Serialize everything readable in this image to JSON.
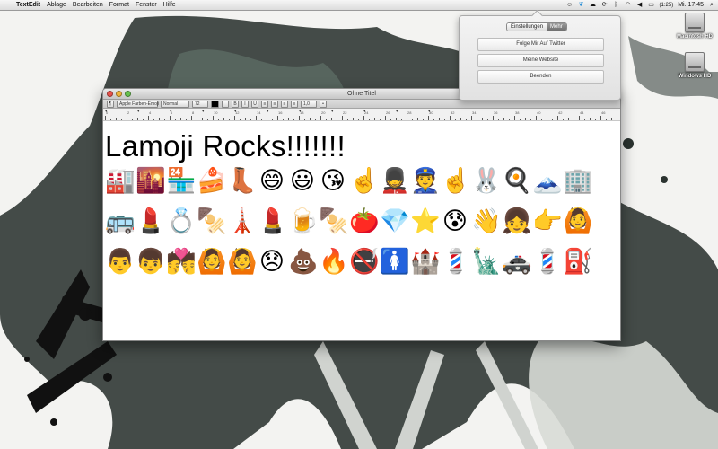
{
  "menubar": {
    "apple_glyph": "",
    "app_name": "TextEdit",
    "menus": [
      "Ablage",
      "Bearbeiten",
      "Format",
      "Fenster",
      "Hilfe"
    ],
    "battery": "(1:25)",
    "clock": "Mi. 17:45",
    "status_icons": [
      "lamoji-icon",
      "twitter-bird-icon",
      "cloud-icon",
      "sync-icon",
      "bluetooth-icon",
      "wifi-icon",
      "volume-icon",
      "battery-icon",
      "spotlight-icon"
    ]
  },
  "desktop": {
    "icons": [
      {
        "label": "Macintosh HD"
      },
      {
        "label": "Windows HD"
      }
    ]
  },
  "popover": {
    "tabs": [
      {
        "label": "Einstellungen",
        "selected": false
      },
      {
        "label": "Mehr",
        "selected": true
      }
    ],
    "buttons": [
      "Folge Mir Auf Twitter",
      "Meine Website",
      "Beenden"
    ]
  },
  "window": {
    "title": "Ohne Titel",
    "toolbar": {
      "font_family": "Apple Farben-Emoji",
      "typeface": "Normal",
      "font_size": "72",
      "styles": [
        "B",
        "I",
        "U"
      ],
      "line_spacing": "1,0"
    },
    "ruler_numbers": [
      "0",
      "2",
      "4",
      "6",
      "8",
      "10",
      "12",
      "14",
      "16",
      "18",
      "20",
      "22",
      "24",
      "26",
      "28",
      "30",
      "32",
      "34",
      "36",
      "38",
      "40",
      "42",
      "44",
      "46"
    ],
    "document": {
      "heading": "Lamoji Rocks!!!!!!!",
      "emoji_rows": [
        [
          "🏭",
          "🌇",
          "🏪",
          "🍰",
          "👢",
          "😄",
          "😃",
          "😘",
          "☝️",
          "💂",
          "👮",
          "☝️",
          "🐰",
          "🍳",
          "🗻",
          "🏢"
        ],
        [
          "🚌",
          "💄",
          "💍",
          "🍢",
          "🗼",
          "💄",
          "🍺",
          "🍢",
          "🍅",
          "💎",
          "⭐",
          "😰",
          "👋",
          "👧",
          "👉",
          "🙆"
        ],
        [
          "👨",
          "👦",
          "💏",
          "🙆",
          "🙆",
          "😞",
          "💩",
          "🔥",
          "🚭",
          "🚺",
          "🏰",
          "💈",
          "🗽",
          "🚓",
          "💈",
          "⛽"
        ]
      ]
    }
  },
  "colors": {
    "close": "#e8524a",
    "minimize": "#f0b43a",
    "zoom": "#67c14d"
  }
}
